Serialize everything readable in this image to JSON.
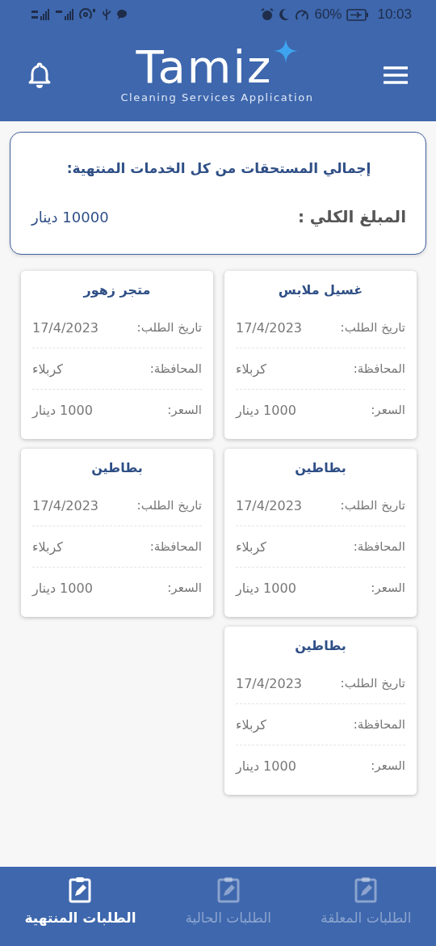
{
  "status_bar": {
    "battery": "60%",
    "time": "10:03"
  },
  "header": {
    "logo": "Tamiz",
    "tagline": "Cleaning Services Application"
  },
  "summary": {
    "title": "إجمالي المستحقات من كل الخدمات المنتهية:",
    "label": "المبلغ الكلي :",
    "amount": "10000 دينار"
  },
  "orders": [
    {
      "title": "غسيل ملابس",
      "fields": [
        {
          "label": "تاريخ الطلب:",
          "value": "17/4/2023"
        },
        {
          "label": "المحافظة:",
          "value": "كربلاء"
        },
        {
          "label": "السعر:",
          "value": "1000 دينار"
        }
      ]
    },
    {
      "title": "متجر زهور",
      "fields": [
        {
          "label": "تاريخ الطلب:",
          "value": "17/4/2023"
        },
        {
          "label": "المحافظة:",
          "value": "كربلاء"
        },
        {
          "label": "السعر:",
          "value": "1000 دينار"
        }
      ]
    },
    {
      "title": "بطاطين",
      "fields": [
        {
          "label": "تاريخ الطلب:",
          "value": "17/4/2023"
        },
        {
          "label": "المحافظة:",
          "value": "كربلاء"
        },
        {
          "label": "السعر:",
          "value": "1000 دينار"
        }
      ]
    },
    {
      "title": "بطاطين",
      "fields": [
        {
          "label": "تاريخ الطلب:",
          "value": "17/4/2023"
        },
        {
          "label": "المحافظة:",
          "value": "كربلاء"
        },
        {
          "label": "السعر:",
          "value": "1000 دينار"
        }
      ]
    },
    {
      "title": "بطاطين",
      "fields": [
        {
          "label": "تاريخ الطلب:",
          "value": "17/4/2023"
        },
        {
          "label": "المحافظة:",
          "value": "كربلاء"
        },
        {
          "label": "السعر:",
          "value": "1000 دينار"
        }
      ]
    }
  ],
  "tabs": [
    {
      "label": "الطلبات المعلقة",
      "selected": false
    },
    {
      "label": "الطلبات الحالية",
      "selected": false
    },
    {
      "label": "الطلبات المنتهية",
      "selected": true
    }
  ]
}
